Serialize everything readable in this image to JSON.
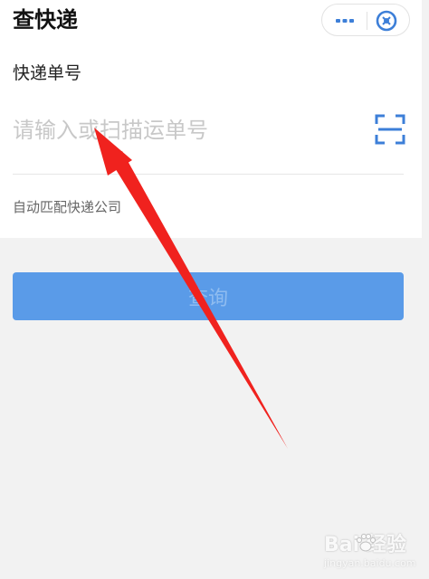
{
  "header": {
    "title": "查快递",
    "more_icon": "more-icon",
    "close_icon": "close-icon"
  },
  "form": {
    "field_label": "快递单号",
    "input_placeholder": "请输入或扫描运单号",
    "input_value": "",
    "scan_icon": "scan-icon",
    "hint": "自动匹配快递公司"
  },
  "actions": {
    "query_label": "查询"
  },
  "watermark": {
    "main": "Bai 经验",
    "sub": "jingyan.baidu.com"
  },
  "colors": {
    "accent": "#3d7fd8",
    "button": "#5a9be8",
    "annotation": "#f0221e",
    "background": "#f2f2f2"
  }
}
